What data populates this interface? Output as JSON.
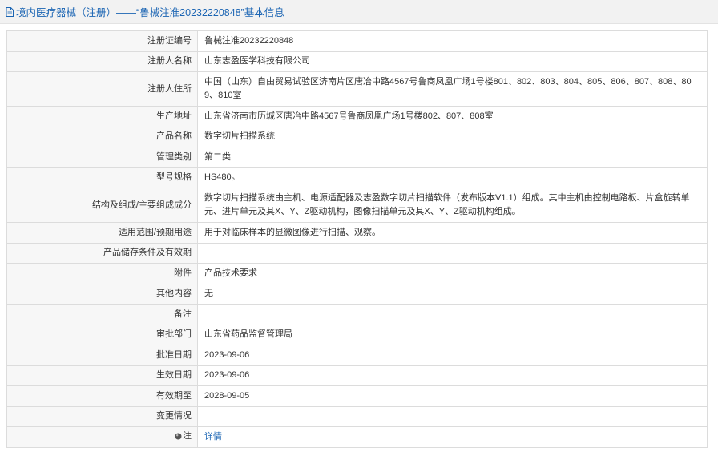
{
  "header": {
    "title": "境内医疗器械（注册）——“鲁械注准20232220848”基本信息",
    "icon": "document-icon",
    "accent": "#1a64b3"
  },
  "table": {
    "rows": [
      {
        "label": "注册证编号",
        "value": "鲁械注准20232220848"
      },
      {
        "label": "注册人名称",
        "value": "山东志盈医学科技有限公司"
      },
      {
        "label": "注册人住所",
        "value": "中国（山东）自由贸易试验区济南片区唐冶中路4567号鲁商凤凰广场1号楼801、802、803、804、805、806、807、808、809、810室"
      },
      {
        "label": "生产地址",
        "value": "山东省济南市历城区唐冶中路4567号鲁商凤凰广场1号楼802、807、808室"
      },
      {
        "label": "产品名称",
        "value": "数字切片扫描系统"
      },
      {
        "label": "管理类别",
        "value": "第二类"
      },
      {
        "label": "型号规格",
        "value": "HS480。"
      },
      {
        "label": "结构及组成/主要组成成分",
        "value": "数字切片扫描系统由主机、电源适配器及志盈数字切片扫描软件（发布版本V1.1）组成。其中主机由控制电路板、片盒旋转单元、进片单元及其X、Y、Z驱动机构，图像扫描单元及其X、Y、Z驱动机构组成。"
      },
      {
        "label": "适用范围/预期用途",
        "value": "用于对临床样本的显微图像进行扫描、观察。"
      },
      {
        "label": "产品储存条件及有效期",
        "value": ""
      },
      {
        "label": "附件",
        "value": "产品技术要求"
      },
      {
        "label": "其他内容",
        "value": "无"
      },
      {
        "label": "备注",
        "value": ""
      },
      {
        "label": "审批部门",
        "value": "山东省药品监督管理局"
      },
      {
        "label": "批准日期",
        "value": "2023-09-06"
      },
      {
        "label": "生效日期",
        "value": "2023-09-06"
      },
      {
        "label": "有效期至",
        "value": "2028-09-05"
      },
      {
        "label": "变更情况",
        "value": ""
      },
      {
        "label": "注",
        "value": "详情",
        "icon": "note-icon"
      }
    ]
  }
}
